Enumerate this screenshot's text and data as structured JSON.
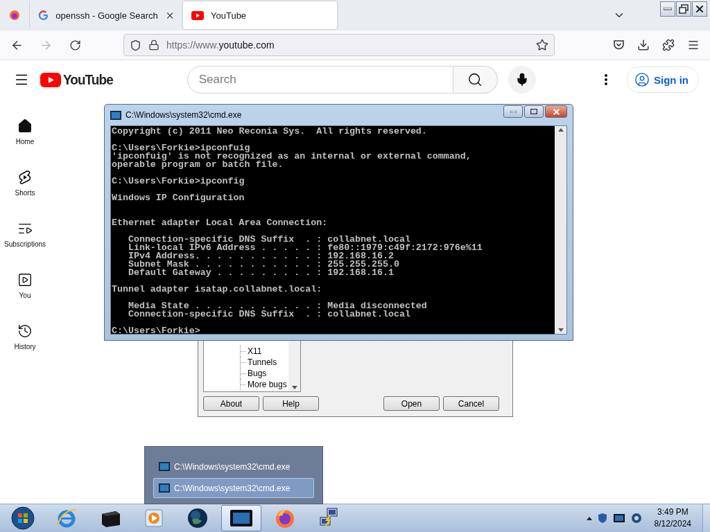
{
  "browser": {
    "tabs": [
      {
        "title": "openssh - Google Search",
        "selected": false
      },
      {
        "title": "YouTube",
        "selected": true
      }
    ],
    "url": {
      "prefix": "https://www.",
      "domain": "youtube.com"
    }
  },
  "youtube": {
    "logo": "YouTube",
    "search": {
      "placeholder": "Search"
    },
    "sign_in": "Sign in",
    "sidebar": [
      {
        "kind": "home",
        "label": "Home"
      },
      {
        "kind": "shorts",
        "label": "Shorts"
      },
      {
        "kind": "subscriptions",
        "label": "Subscriptions"
      },
      {
        "kind": "you",
        "label": "You"
      },
      {
        "kind": "history",
        "label": "History"
      }
    ]
  },
  "cmd_window": {
    "title": "C:\\Windows\\system32\\cmd.exe",
    "output": "Copyright (c) 2011 Neo Reconia Sys.  All rights reserved.\n\nC:\\Users\\Forkie>ipconfuig\n'ipconfuig' is not recognized as an internal or external command,\noperable program or batch file.\n\nC:\\Users\\Forkie>ipconfig\n\nWindows IP Configuration\n\n\nEthernet adapter Local Area Connection:\n\n   Connection-specific DNS Suffix  . : collabnet.local\n   Link-local IPv6 Address . . . . . : fe80::1979:c49f:2172:976e%11\n   IPv4 Address. . . . . . . . . . . : 192.168.16.2\n   Subnet Mask . . . . . . . . . . . : 255.255.255.0\n   Default Gateway . . . . . . . . . : 192.168.16.1\n\nTunnel adapter isatap.collabnet.local:\n\n   Media State . . . . . . . . . . . : Media disconnected\n   Connection-specific DNS Suffix  . : collabnet.local\n\nC:\\Users\\Forkie>"
  },
  "putty_dialog": {
    "tree_items": [
      "X11",
      "Tunnels",
      "Bugs",
      "More bugs"
    ],
    "buttons": [
      "About",
      "Help",
      "Open",
      "Cancel"
    ]
  },
  "taskbar_preview": {
    "items": [
      {
        "title": "C:\\Windows\\system32\\cmd.exe",
        "selected": false
      },
      {
        "title": "C:\\Windows\\system32\\cmd.exe",
        "selected": true
      }
    ]
  },
  "taskbar": {
    "apps": [
      {
        "kind": "ie",
        "active": false
      },
      {
        "kind": "box",
        "active": false
      },
      {
        "kind": "media",
        "active": false
      },
      {
        "kind": "globe",
        "active": false
      },
      {
        "kind": "cmd",
        "active": true
      },
      {
        "kind": "firefox",
        "active": false
      },
      {
        "kind": "putty",
        "active": false
      }
    ],
    "clock": {
      "time": "3:49 PM",
      "date": "8/12/2024"
    }
  }
}
